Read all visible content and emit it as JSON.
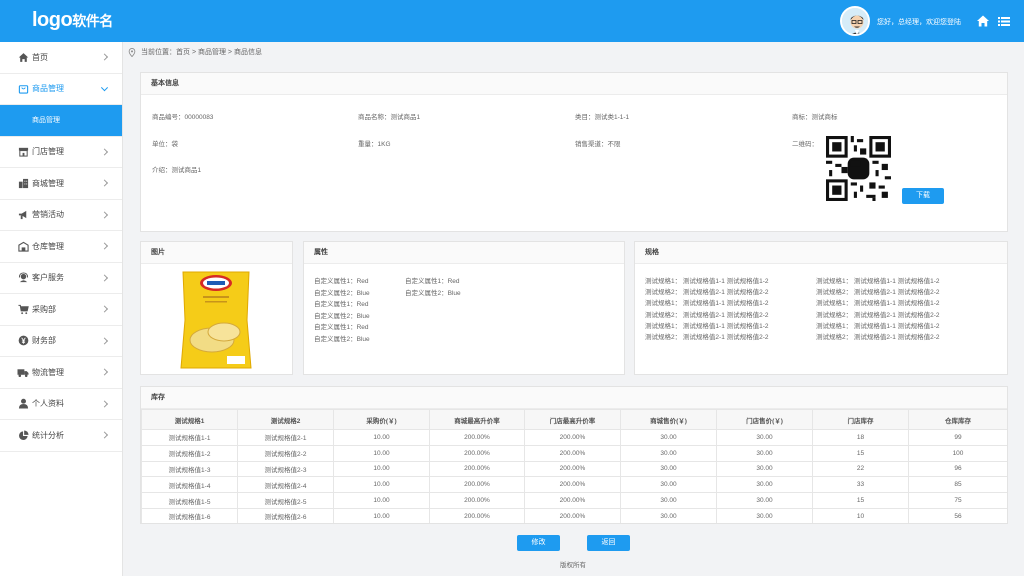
{
  "header": {
    "logo_main": "logo",
    "logo_sub": "软件名",
    "greeting": "您好，总经理，欢迎您登陆"
  },
  "sidebar": {
    "items": [
      {
        "label": "首页",
        "icon": "home-icon"
      },
      {
        "label": "商品管理",
        "icon": "shopping-bag-icon"
      },
      {
        "label": "商品管理",
        "icon": ""
      },
      {
        "label": "门店管理",
        "icon": "store-icon"
      },
      {
        "label": "商城管理",
        "icon": "building-icon"
      },
      {
        "label": "营销活动",
        "icon": "megaphone-icon"
      },
      {
        "label": "仓库管理",
        "icon": "warehouse-icon"
      },
      {
        "label": "客户服务",
        "icon": "customer-service-icon"
      },
      {
        "label": "采购部",
        "icon": "cart-icon"
      },
      {
        "label": "财务部",
        "icon": "yen-icon"
      },
      {
        "label": "物流管理",
        "icon": "truck-icon"
      },
      {
        "label": "个人资料",
        "icon": "user-icon"
      },
      {
        "label": "统计分析",
        "icon": "pie-chart-icon"
      }
    ]
  },
  "breadcrumb": "当前位置：首页 > 商品管理 > 商品信息",
  "basic_info": {
    "title": "基本信息",
    "fields": {
      "code": "商品编号：00000083",
      "name": "商品名称：测试商品1",
      "category": "类目：测试类1-1-1",
      "brand": "商标：测试商标",
      "unit": "单位：袋",
      "weight": "重量：1KG",
      "source": "销售渠道：不限",
      "qrcode": "二维码：",
      "intro": "介绍：测试商品1"
    },
    "download_label": "下载"
  },
  "image_panel": {
    "title": "图片"
  },
  "attr_panel": {
    "title": "属性",
    "col1": [
      "自定义属性1：Red",
      "自定义属性2：Blue",
      "自定义属性1：Red",
      "自定义属性2：Blue",
      "自定义属性1：Red",
      "自定义属性2：Blue"
    ],
    "col2": [
      "自定义属性1：Red",
      "自定义属性2：Blue"
    ]
  },
  "spec_panel": {
    "title": "规格",
    "col1": [
      "测试规格1：  测试规格值1-1  测试规格值1-2",
      "测试规格2：  测试规格值2-1  测试规格值2-2",
      "测试规格1：  测试规格值1-1  测试规格值1-2",
      "测试规格2：  测试规格值2-1  测试规格值2-2",
      "测试规格1：  测试规格值1-1  测试规格值1-2",
      "测试规格2：  测试规格值2-1  测试规格值2-2"
    ],
    "col2": [
      "测试规格1：  测试规格值1-1  测试规格值1-2",
      "测试规格2：  测试规格值2-1  测试规格值2-2",
      "测试规格1：  测试规格值1-1  测试规格值1-2",
      "测试规格2：  测试规格值2-1  测试规格值2-2",
      "测试规格1：  测试规格值1-1  测试规格值1-2",
      "测试规格2：  测试规格值2-1  测试规格值2-2"
    ]
  },
  "stock": {
    "title": "库存",
    "headers": [
      "测试规格1",
      "测试规格2",
      "采购价(￥)",
      "商城最高升价率",
      "门店最高升价率",
      "商城售价(￥)",
      "门店售价(￥)",
      "门店库存",
      "仓库库存"
    ],
    "rows": [
      [
        "测试规格值1-1",
        "测试规格值2-1",
        "10.00",
        "200.00%",
        "200.00%",
        "30.00",
        "30.00",
        "18",
        "99"
      ],
      [
        "测试规格值1-2",
        "测试规格值2-2",
        "10.00",
        "200.00%",
        "200.00%",
        "30.00",
        "30.00",
        "15",
        "100"
      ],
      [
        "测试规格值1-3",
        "测试规格值2-3",
        "10.00",
        "200.00%",
        "200.00%",
        "30.00",
        "30.00",
        "22",
        "96"
      ],
      [
        "测试规格值1-4",
        "测试规格值2-4",
        "10.00",
        "200.00%",
        "200.00%",
        "30.00",
        "30.00",
        "33",
        "85"
      ],
      [
        "测试规格值1-5",
        "测试规格值2-5",
        "10.00",
        "200.00%",
        "200.00%",
        "30.00",
        "30.00",
        "15",
        "75"
      ],
      [
        "测试规格值1-6",
        "测试规格值2-6",
        "10.00",
        "200.00%",
        "200.00%",
        "30.00",
        "30.00",
        "10",
        "56"
      ]
    ]
  },
  "actions": {
    "edit_label": "修改",
    "back_label": "返回"
  },
  "footer": "版权所有",
  "colors": {
    "accent": "#1e9bf0"
  }
}
